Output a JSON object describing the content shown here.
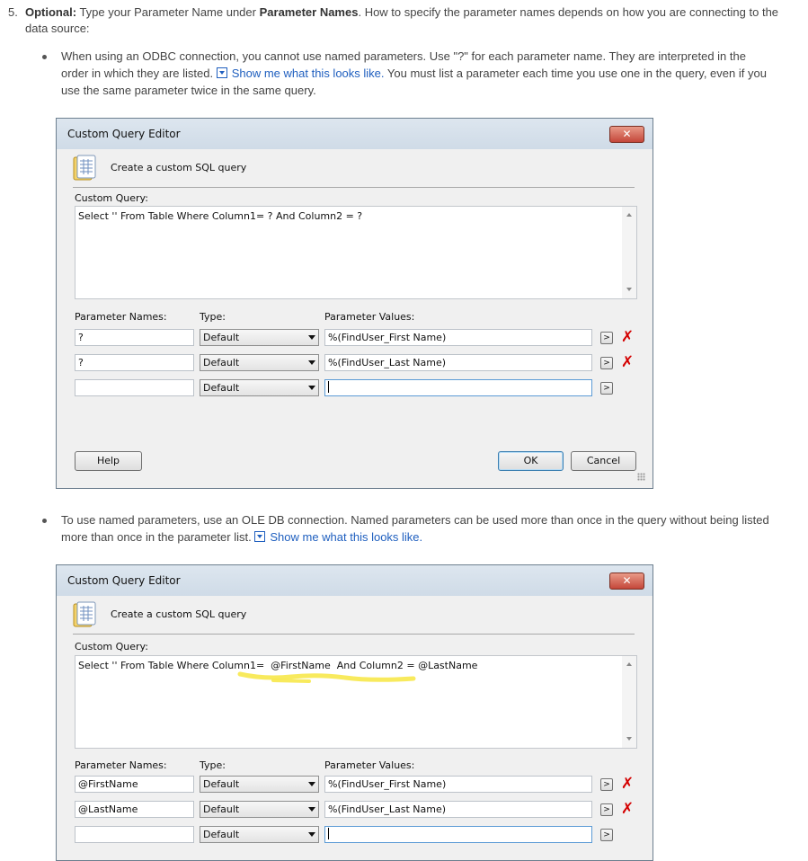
{
  "step": {
    "number": "5.",
    "optional_label": "Optional:",
    "text1": "Type your Parameter Name under",
    "param_names_label": "Parameter Names",
    "text2": ". How to specify the parameter names depends on how you are connecting to the data source:"
  },
  "bullets": [
    {
      "text_before": "When using an ODBC connection, you cannot use named parameters. Use \"?\" for each parameter name. They are interpreted in the order in which they are listed.",
      "link": "Show me what this looks like.",
      "text_after": "You must list a parameter each time you use one in the query, even if you use the same parameter twice in the same query."
    },
    {
      "text_before": "To use named parameters, use an OLE DB connection. Named parameters can be used more than once in the query without being listed more than once in the parameter list.",
      "link": "Show me what this looks like.",
      "text_after": ""
    }
  ],
  "dialogs": [
    {
      "title": "Custom Query Editor",
      "close": "✕",
      "header": "Create a custom SQL query",
      "query_label": "Custom Query:",
      "query": "Select '' From Table Where Column1= ? And Column2 = ?",
      "col_names": "Parameter Names:",
      "col_type": "Type:",
      "col_values": "Parameter Values:",
      "rows": [
        {
          "name": "?",
          "type": "Default",
          "value": "%(FindUser_First Name)"
        },
        {
          "name": "?",
          "type": "Default",
          "value": "%(FindUser_Last Name)"
        },
        {
          "name": "",
          "type": "Default",
          "value": ""
        }
      ],
      "ellipsis": ">",
      "delete": "✗",
      "help": "Help",
      "ok": "OK",
      "cancel": "Cancel"
    },
    {
      "title": "Custom Query Editor",
      "close": "✕",
      "header": "Create a custom SQL query",
      "query_label": "Custom Query:",
      "query": "Select '' From Table Where Column1=  @FirstName  And Column2 = @LastName",
      "col_names": "Parameter Names:",
      "col_type": "Type:",
      "col_values": "Parameter Values:",
      "rows": [
        {
          "name": "@FirstName",
          "type": "Default",
          "value": "%(FindUser_First Name)"
        },
        {
          "name": "@LastName",
          "type": "Default",
          "value": "%(FindUser_Last Name)"
        },
        {
          "name": "",
          "type": "Default",
          "value": ""
        }
      ],
      "ellipsis": ">",
      "delete": "✗"
    }
  ],
  "colors": {
    "link": "#1f5fbf",
    "delete": "#d40000",
    "highlight": "#f7e84b"
  }
}
